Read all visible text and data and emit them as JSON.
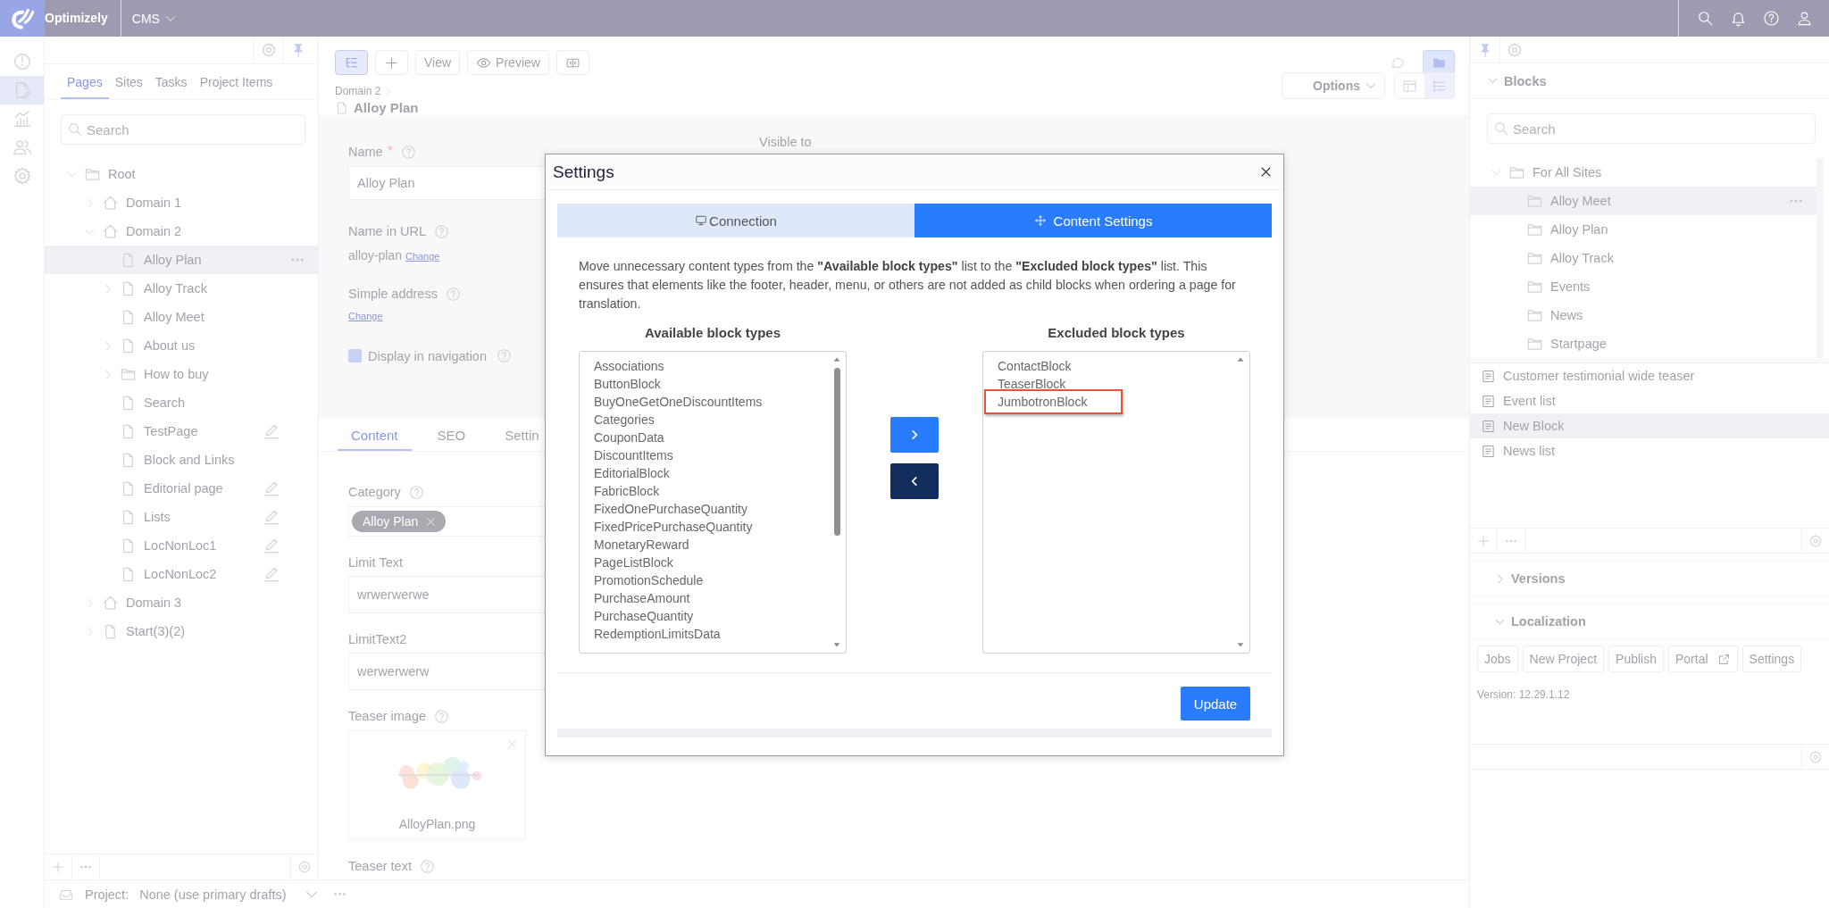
{
  "top_bar": {
    "brand": "Optimizely",
    "product_menu": "CMS"
  },
  "nav_rail": [
    {
      "kind": "dashboard",
      "selected": false
    },
    {
      "kind": "edit",
      "selected": true
    },
    {
      "kind": "reports",
      "selected": false
    },
    {
      "kind": "users",
      "selected": false
    },
    {
      "kind": "settings",
      "selected": false
    }
  ],
  "pages_panel": {
    "tabs": [
      {
        "label": "Pages",
        "selected": true
      },
      {
        "label": "Sites",
        "selected": false
      },
      {
        "label": "Tasks",
        "selected": false
      },
      {
        "label": "Project Items",
        "selected": false
      }
    ],
    "search": {
      "placeholder": "Search"
    },
    "tree": [
      {
        "label": "Root",
        "kind": "folder",
        "expanded": true,
        "selected": false,
        "draft": false,
        "children": [
          {
            "label": "Domain 1",
            "kind": "site",
            "expanded": false,
            "selected": false,
            "draft": false
          },
          {
            "label": "Domain 2",
            "kind": "site",
            "expanded": true,
            "selected": false,
            "draft": false,
            "children": [
              {
                "label": "Alloy Plan",
                "kind": "page",
                "selected": true,
                "draft": false
              },
              {
                "label": "Alloy Track",
                "kind": "page",
                "expanded": false,
                "selected": false,
                "draft": false
              },
              {
                "label": "Alloy Meet",
                "kind": "page",
                "selected": false,
                "draft": false
              },
              {
                "label": "About us",
                "kind": "page",
                "expanded": false,
                "selected": false,
                "draft": false
              },
              {
                "label": "How to buy",
                "kind": "folder",
                "expanded": false,
                "selected": false,
                "draft": false
              },
              {
                "label": "Search",
                "kind": "page",
                "selected": false,
                "draft": false
              },
              {
                "label": "TestPage",
                "kind": "page",
                "selected": false,
                "draft": true
              },
              {
                "label": "Block and Links",
                "kind": "page",
                "selected": false,
                "draft": false
              },
              {
                "label": "Editorial page",
                "kind": "page",
                "selected": false,
                "draft": true
              },
              {
                "label": "Lists",
                "kind": "page",
                "selected": false,
                "draft": true
              },
              {
                "label": "LocNonLoc1",
                "kind": "page",
                "selected": false,
                "draft": true
              },
              {
                "label": "LocNonLoc2",
                "kind": "page",
                "selected": false,
                "draft": true
              }
            ]
          },
          {
            "label": "Domain 3",
            "kind": "site",
            "expanded": false,
            "selected": false,
            "draft": false
          },
          {
            "label": "Start(3)(2)",
            "kind": "page",
            "expanded": false,
            "selected": false,
            "draft": false
          }
        ]
      }
    ]
  },
  "project_bar": {
    "label": "Project:",
    "value": "None (use primary drafts)"
  },
  "content_header": {
    "toolbar": [
      {
        "kind": "tree",
        "active": true
      },
      {
        "kind": "add",
        "active": false
      },
      {
        "kind": "text",
        "label": "View",
        "active": false
      },
      {
        "kind": "preview",
        "label": "Preview",
        "active": false
      },
      {
        "kind": "compare",
        "active": false
      }
    ],
    "header_tools": [
      {
        "kind": "comments",
        "active": false
      },
      {
        "kind": "assets",
        "active": true
      }
    ],
    "breadcrumb": "Domain 2",
    "title": "Alloy Plan",
    "options": "Options",
    "view_toggles": [
      {
        "kind": "layout",
        "selected": false
      },
      {
        "kind": "list",
        "selected": true
      }
    ]
  },
  "form": {
    "top_fields": [
      {
        "kind": "input",
        "label": "Name",
        "required_mark": "*",
        "help": true,
        "value": "Alloy Plan"
      },
      {
        "kind": "link",
        "label": "Name in URL",
        "help": true,
        "value": "alloy-plan",
        "link": "Change"
      },
      {
        "kind": "link",
        "label": "Simple address",
        "help": true,
        "link": "Change"
      },
      {
        "kind": "checkbox",
        "label": "Display in navigation",
        "help": true,
        "checked": true
      }
    ],
    "visible_to": "Visible to",
    "tabs": [
      {
        "label": "Content",
        "selected": true
      },
      {
        "label": "SEO",
        "selected": false
      },
      {
        "label": "Settin",
        "selected": false
      }
    ],
    "fields": [
      {
        "kind": "tags",
        "label": "Category",
        "help": true,
        "tags": [
          "Alloy Plan"
        ]
      },
      {
        "kind": "input",
        "label": "Limit Text",
        "help": false,
        "value": "wrwerwerwe"
      },
      {
        "kind": "input",
        "label": "LimitText2",
        "help": false,
        "value": "werwerwerw"
      },
      {
        "label": "Teaser image",
        "help": true,
        "file": "AlloyPlan.png"
      },
      {
        "kind": "label",
        "label": "Teaser text",
        "help": true
      }
    ]
  },
  "modal": {
    "title": "Settings",
    "tabs": [
      {
        "label": "Connection",
        "kind": "monitor",
        "selected": false
      },
      {
        "label": "Content Settings",
        "kind": "move",
        "selected": true
      }
    ],
    "description": "Move unnecessary content types from the **\"Available block types\"** list to the **\"Excluded block types\"** list. This ensures that elements like the footer, header, menu, or others are not added as child blocks when ordering a page for translation.",
    "available": {
      "title": "Available block types",
      "items": [
        {
          "label": "Associations",
          "highlighted": false
        },
        {
          "label": "ButtonBlock",
          "highlighted": false
        },
        {
          "label": "BuyOneGetOneDiscountItems",
          "highlighted": false
        },
        {
          "label": "Categories",
          "highlighted": false
        },
        {
          "label": "CouponData",
          "highlighted": false
        },
        {
          "label": "DiscountItems",
          "highlighted": false
        },
        {
          "label": "EditorialBlock",
          "highlighted": false
        },
        {
          "label": "FabricBlock",
          "highlighted": false
        },
        {
          "label": "FixedOnePurchaseQuantity",
          "highlighted": false
        },
        {
          "label": "FixedPricePurchaseQuantity",
          "highlighted": false
        },
        {
          "label": "MonetaryReward",
          "highlighted": false
        },
        {
          "label": "PageListBlock",
          "highlighted": false
        },
        {
          "label": "PromotionSchedule",
          "highlighted": false
        },
        {
          "label": "PurchaseAmount",
          "highlighted": false
        },
        {
          "label": "PurchaseQuantity",
          "highlighted": false
        },
        {
          "label": "RedemptionLimitsData",
          "highlighted": false
        }
      ]
    },
    "excluded": {
      "title": "Excluded block types",
      "items": [
        {
          "label": "ContactBlock",
          "highlighted": false
        },
        {
          "label": "TeaserBlock",
          "highlighted": false
        },
        {
          "label": "JumbotronBlock",
          "highlighted": true
        }
      ]
    },
    "update_button": "Update"
  },
  "blocks_panel": {
    "title": "Blocks",
    "expanded": true,
    "search": {
      "placeholder": "Search"
    },
    "tree": [
      {
        "label": "For All Sites",
        "kind": "folder",
        "expanded": true,
        "selected": false,
        "draft": false,
        "children": [
          {
            "label": "Alloy Meet",
            "kind": "folder",
            "selected": true,
            "draft": false
          },
          {
            "label": "Alloy Plan",
            "kind": "folder",
            "selected": false,
            "draft": false
          },
          {
            "label": "Alloy Track",
            "kind": "folder",
            "selected": false,
            "draft": false
          },
          {
            "label": "Events",
            "kind": "folder",
            "selected": false,
            "draft": false
          },
          {
            "label": "News",
            "kind": "folder",
            "selected": false,
            "draft": false
          },
          {
            "label": "Startpage",
            "kind": "folder",
            "selected": false,
            "draft": false
          }
        ]
      }
    ],
    "items": [
      {
        "label": "Customer testimonial wide teaser",
        "highlighted": false
      },
      {
        "label": "Event list",
        "highlighted": false
      },
      {
        "label": "New Block",
        "highlighted": true
      },
      {
        "label": "News list",
        "highlighted": false
      }
    ]
  },
  "versions": {
    "title": "Versions",
    "expanded": false
  },
  "localization": {
    "title": "Localization",
    "expanded": true,
    "buttons": [
      {
        "label": "Jobs",
        "external": false
      },
      {
        "label": "New Project",
        "external": false
      },
      {
        "label": "Publish",
        "external": false
      },
      {
        "label": "Portal",
        "external": true
      },
      {
        "label": "Settings",
        "external": false
      }
    ],
    "version": "Version: 12.29.1.12"
  }
}
